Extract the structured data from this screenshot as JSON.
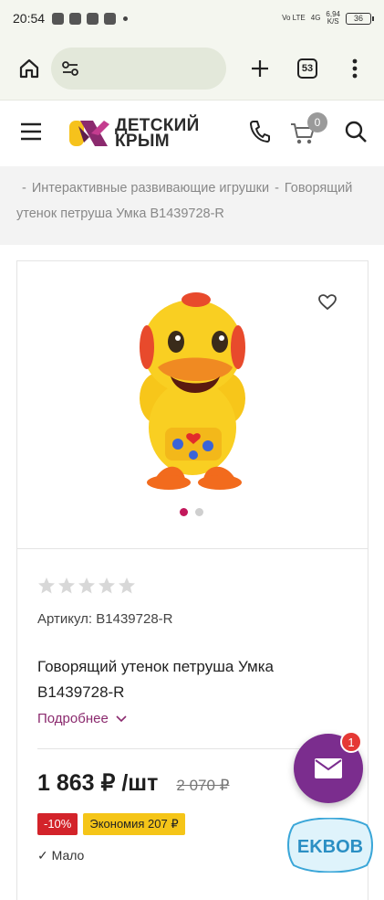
{
  "status_bar": {
    "time": "20:54",
    "network": "Vo LTE",
    "signal": "4G",
    "speed_value": "6,94",
    "speed_unit": "K/S",
    "battery": "36"
  },
  "browser": {
    "tab_count": "53"
  },
  "site": {
    "logo_line1": "ДЕТСКИЙ",
    "logo_line2": "КРЫМ",
    "cart_count": "0",
    "brand_color": "#8b2a6e"
  },
  "breadcrumb": {
    "items": [
      "Интерактивные развивающие игрушки",
      "Говорящий утенок петруша Умка B1439728-R"
    ]
  },
  "product": {
    "article_label": "Артикул: B1439728-R",
    "title": "Говорящий утенок петруша Умка B1439728-R",
    "more_label": "Подробнее",
    "price": "1 863 ₽ /шт",
    "old_price": "2 070 ₽",
    "discount": "-10%",
    "savings": "Экономия 207 ₽",
    "rating": 0,
    "image_count": 2,
    "below_text": "Мало"
  },
  "chat": {
    "badge": "1"
  },
  "watermark": {
    "text": "EKBOB"
  }
}
